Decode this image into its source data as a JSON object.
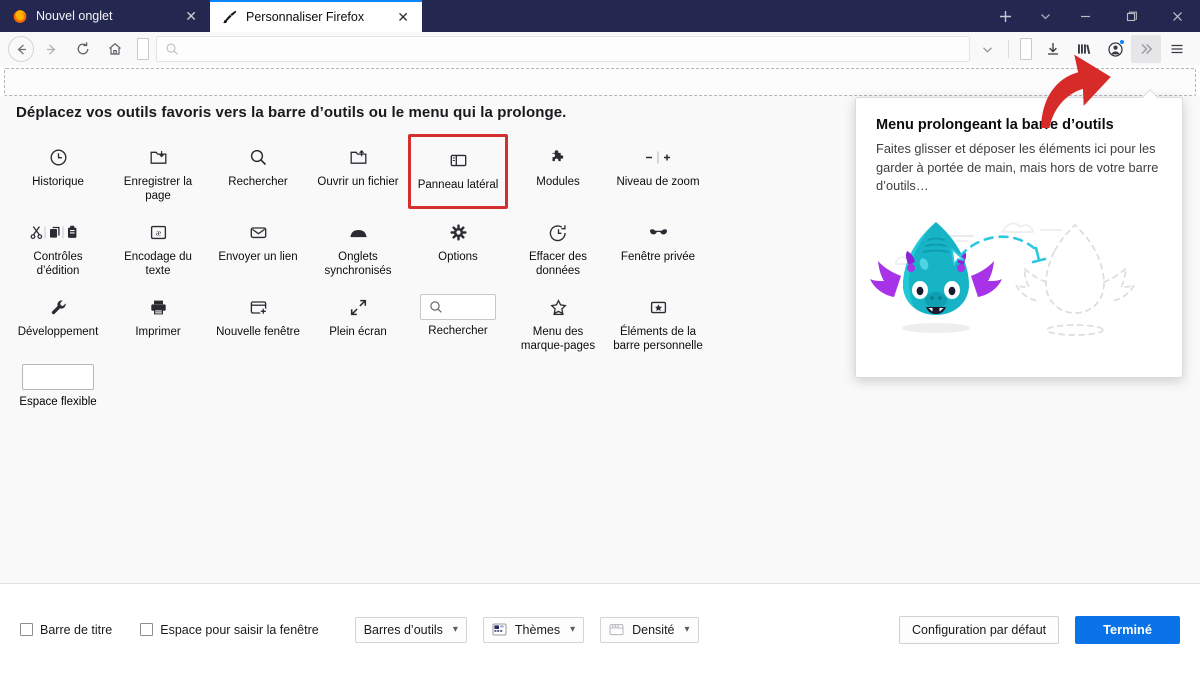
{
  "window": {
    "tabs": [
      {
        "title": "Nouvel onglet",
        "icon": "firefox-logo-icon",
        "active": false
      },
      {
        "title": "Personnaliser Firefox",
        "icon": "paintbrush-icon",
        "active": true
      }
    ],
    "controls": {
      "new_tab": "+",
      "tab_list": "chevron-down-icon",
      "minimize": "minimize-icon",
      "maximize": "maximize-icon",
      "close": "close-icon"
    }
  },
  "navbar": {
    "back": "back-arrow-icon",
    "forward": "forward-arrow-icon",
    "reload": "reload-icon",
    "home": "home-icon",
    "flexible_space": "flexible-space-slot",
    "urlbar_placeholder": "",
    "urlbar_icon": "search-icon",
    "right_items": [
      {
        "name": "chevron-down-icon",
        "label": ""
      },
      {
        "name": "flexible-space-slot",
        "label": ""
      },
      {
        "name": "downloads-icon",
        "label": ""
      },
      {
        "name": "library-icon",
        "label": ""
      },
      {
        "name": "account-icon",
        "label": "",
        "badge": true
      },
      {
        "name": "overflow-menu-icon",
        "label": "»",
        "highlighted": true
      },
      {
        "name": "hamburger-menu-icon",
        "label": ""
      }
    ]
  },
  "customize": {
    "headline": "Déplacez vos outils favoris vers la barre d’outils ou le menu qui la prolonge.",
    "palette": [
      {
        "label": "Historique",
        "icon": "clock-icon",
        "highlighted": false
      },
      {
        "label": "Enregistrer la page",
        "icon": "save-page-icon",
        "highlighted": false
      },
      {
        "label": "Rechercher",
        "icon": "search-icon",
        "highlighted": false
      },
      {
        "label": "Ouvrir un fichier",
        "icon": "open-file-icon",
        "highlighted": false
      },
      {
        "label": "Panneau latéral",
        "icon": "sidebar-icon",
        "highlighted": true
      },
      {
        "label": "Modules",
        "icon": "addons-puzzle-icon",
        "highlighted": false
      },
      {
        "label": "Niveau de zoom",
        "icon": "zoom-level-icon",
        "highlighted": false
      },
      {
        "label": "Contrôles d’édition",
        "icon": "edit-controls-icon",
        "highlighted": false
      },
      {
        "label": "Encodage du texte",
        "icon": "text-encoding-icon",
        "highlighted": false
      },
      {
        "label": "Envoyer un lien",
        "icon": "email-link-icon",
        "highlighted": false
      },
      {
        "label": "Onglets synchronisés",
        "icon": "synced-tabs-icon",
        "highlighted": false
      },
      {
        "label": "Options",
        "icon": "preferences-gear-icon",
        "highlighted": false
      },
      {
        "label": "Effacer des données",
        "icon": "forget-history-icon",
        "highlighted": false
      },
      {
        "label": "Fenêtre privée",
        "icon": "private-window-mask-icon",
        "highlighted": false
      },
      {
        "label": "Développement",
        "icon": "wrench-devtools-icon",
        "highlighted": false
      },
      {
        "label": "Imprimer",
        "icon": "printer-icon",
        "highlighted": false
      },
      {
        "label": "Nouvelle fenêtre",
        "icon": "new-window-icon",
        "highlighted": false
      },
      {
        "label": "Plein écran",
        "icon": "fullscreen-icon",
        "highlighted": false
      },
      {
        "label": "Rechercher",
        "icon": "search-box-widget",
        "highlighted": false
      },
      {
        "label": "Menu des marque-pages",
        "icon": "bookmarks-star-icon",
        "highlighted": false
      },
      {
        "label": "Éléments de la barre personnelle",
        "icon": "bookmarks-toolbar-items-icon",
        "highlighted": false
      }
    ],
    "flexible_space": {
      "label": "Espace flexible",
      "icon": "flexible-space-widget"
    },
    "highlight_color": "#d32f2f"
  },
  "panel": {
    "title": "Menu prolongeant la barre d’outils",
    "body": "Faites glisser et déposer les éléments ici pour les garder à portée de main, mais hors de votre barre d’outils…",
    "illustration": "drag-drop-creature-illustration",
    "illustration_colors": {
      "body": "#17b4c6",
      "fins": "#a732e8",
      "dashes": "#2ec7e0"
    }
  },
  "bottombar": {
    "checkboxes": [
      {
        "label": "Barre de titre",
        "checked": false
      },
      {
        "label": "Espace pour saisir la fenêtre",
        "checked": false
      }
    ],
    "dropdowns": [
      {
        "label": "Barres d’outils",
        "icon": null
      },
      {
        "label": "Thèmes",
        "icon": "themes-icon"
      },
      {
        "label": "Densité",
        "icon": "density-icon"
      }
    ],
    "reset_button": "Configuration par défaut",
    "done_button": "Terminé",
    "done_color": "#0a73e8"
  }
}
